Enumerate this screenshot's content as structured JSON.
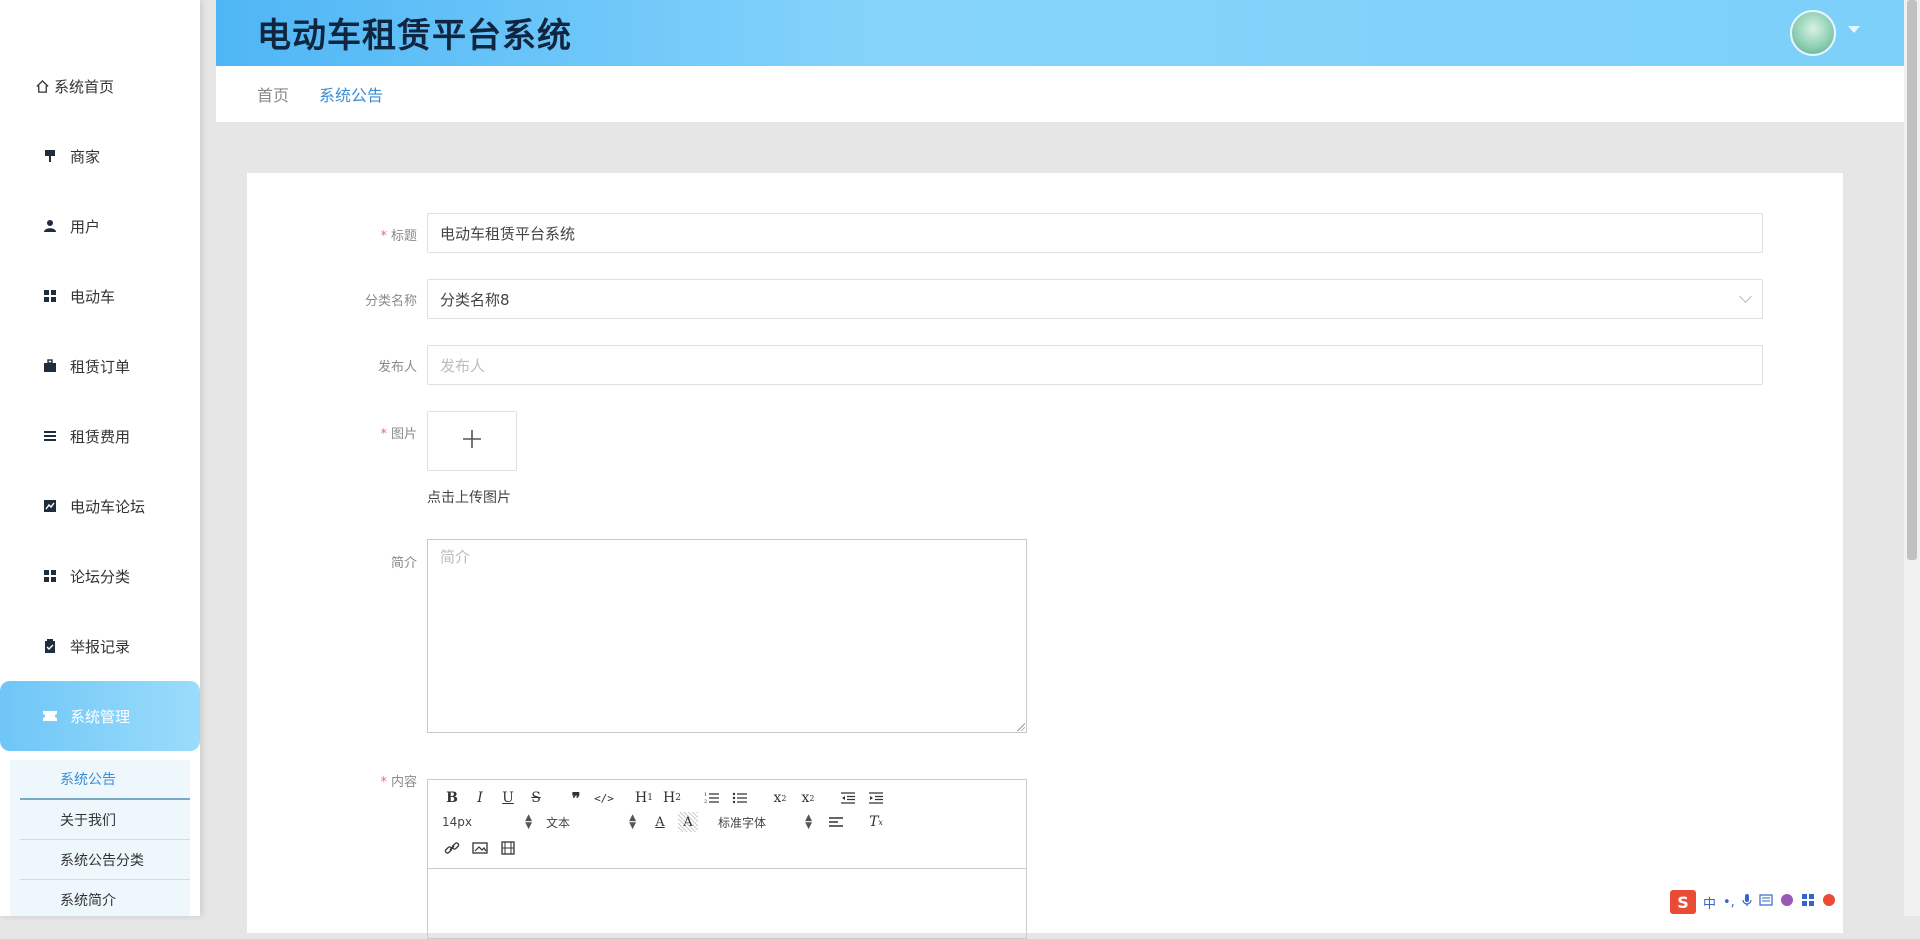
{
  "header": {
    "title": "电动车租赁平台系统"
  },
  "sidebar": {
    "items": [
      {
        "label": "系统首页",
        "icon": "home-icon"
      },
      {
        "label": "商家",
        "icon": "store-icon"
      },
      {
        "label": "用户",
        "icon": "user-icon"
      },
      {
        "label": "电动车",
        "icon": "grid-icon"
      },
      {
        "label": "租赁订单",
        "icon": "briefcase-icon"
      },
      {
        "label": "租赁费用",
        "icon": "list-icon"
      },
      {
        "label": "电动车论坛",
        "icon": "chart-icon"
      },
      {
        "label": "论坛分类",
        "icon": "grid-icon"
      },
      {
        "label": "举报记录",
        "icon": "clipboard-icon"
      },
      {
        "label": "系统管理",
        "icon": "ticket-icon"
      }
    ],
    "submenu": [
      {
        "label": "系统公告"
      },
      {
        "label": "关于我们"
      },
      {
        "label": "系统公告分类"
      },
      {
        "label": "系统简介"
      }
    ]
  },
  "breadcrumb": {
    "home": "首页",
    "current": "系统公告"
  },
  "form": {
    "title_label": "标题",
    "title_value": "电动车租赁平台系统",
    "category_label": "分类名称",
    "category_value": "分类名称8",
    "publisher_label": "发布人",
    "publisher_placeholder": "发布人",
    "image_label": "图片",
    "upload_text": "点击上传图片",
    "intro_label": "简介",
    "intro_placeholder": "简介",
    "content_label": "内容",
    "required_mark": "*"
  },
  "editor": {
    "font_size": "14px",
    "header_select": "文本",
    "font_family": "标准字体"
  },
  "tray": {
    "ime_label": "中",
    "ime_logo": "S"
  },
  "colors": {
    "accent": "#3a8ed6",
    "header_start": "#4fb6f5",
    "header_end": "#86d4fb",
    "required": "#f56c6c"
  }
}
